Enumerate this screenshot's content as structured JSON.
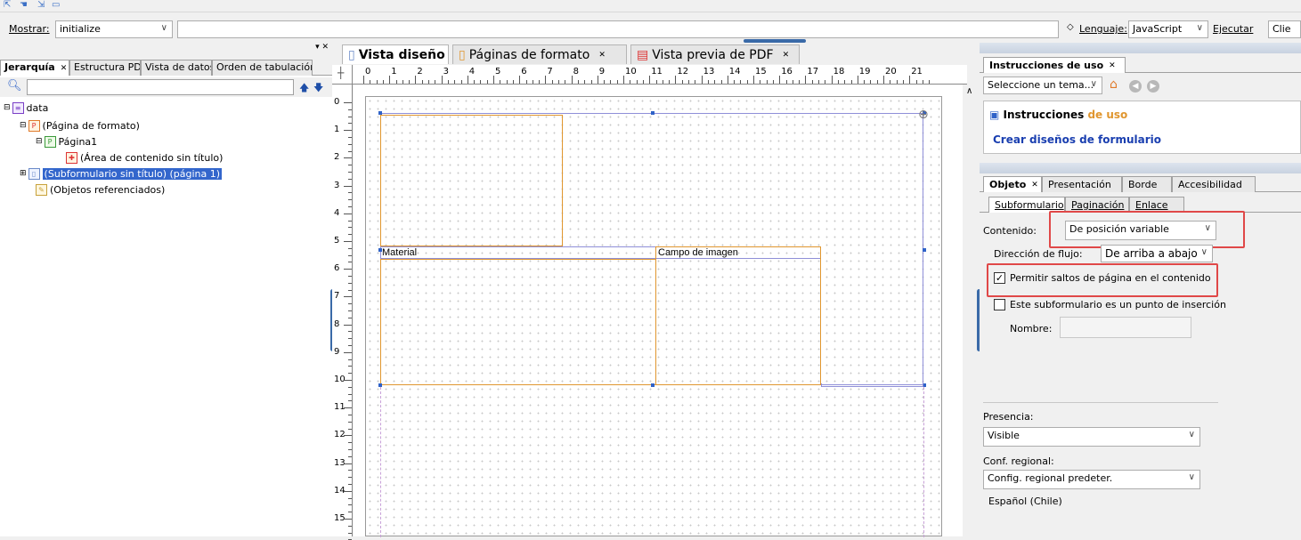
{
  "script_bar": {
    "show_label": "Mostrar:",
    "show_value": "initialize",
    "language_label": "Lenguaje:",
    "language_value": "JavaScript",
    "execute_label": "Ejecutar",
    "client_value": "Clie"
  },
  "left_panel": {
    "tabs": [
      "Jerarquía",
      "Estructura PDF",
      "Vista de datos",
      "Orden de tabulación"
    ],
    "tree": [
      {
        "label": "data",
        "level": 0
      },
      {
        "label": "(Página de formato)",
        "level": 1
      },
      {
        "label": "Página1",
        "level": 2
      },
      {
        "label": "(Área de contenido sin título)",
        "level": 3
      },
      {
        "label": "(Subformulario sin título) (página 1)",
        "level": 1,
        "selected": true
      },
      {
        "label": "(Objetos referenciados)",
        "level": 1
      }
    ]
  },
  "design": {
    "tabs": [
      "Vista diseño",
      "Páginas de formato",
      "Vista previa de PDF"
    ],
    "ruler_h": [
      "0",
      "1",
      "2",
      "3",
      "4",
      "5",
      "6",
      "7",
      "8",
      "9",
      "10",
      "11",
      "12",
      "13",
      "14",
      "15",
      "16",
      "17",
      "18",
      "19",
      "20",
      "21"
    ],
    "ruler_v": [
      "0",
      "1",
      "2",
      "3",
      "4",
      "5",
      "6",
      "7",
      "8",
      "9",
      "10",
      "11",
      "12",
      "13",
      "14",
      "15"
    ],
    "field_material": "Material",
    "field_image": "Campo de imagen"
  },
  "right_panel": {
    "help_tab": "Instrucciones de uso",
    "topic_placeholder": "Seleccione un tema...",
    "help_heading_a": "Instrucciones ",
    "help_heading_b": "de uso",
    "help_link": "Crear diseños de formulario",
    "object_tabs": [
      "Objeto",
      "Presentación",
      "Borde",
      "Accesibilidad"
    ],
    "sub_tabs": [
      "Subformulario",
      "Paginación",
      "Enlace"
    ],
    "content_label": "Contenido:",
    "content_value": "De posición variable",
    "flow_label": "Dirección de flujo:",
    "flow_value": "De arriba a abajo",
    "allow_breaks": "Permitir saltos de página en el contenido",
    "insertion_point": "Este subformulario es un punto de inserción",
    "name_label": "Nombre:",
    "presence_label": "Presencia:",
    "presence_value": "Visible",
    "locale_label": "Conf. regional:",
    "locale_value": "Config. regional predeter.",
    "locale_note": "Español (Chile)"
  },
  "colors": {
    "highlight_red": "#e04848",
    "selection_blue": "#3366cc",
    "field_orange": "#e0962f",
    "link_blue": "#1a3fb0"
  }
}
